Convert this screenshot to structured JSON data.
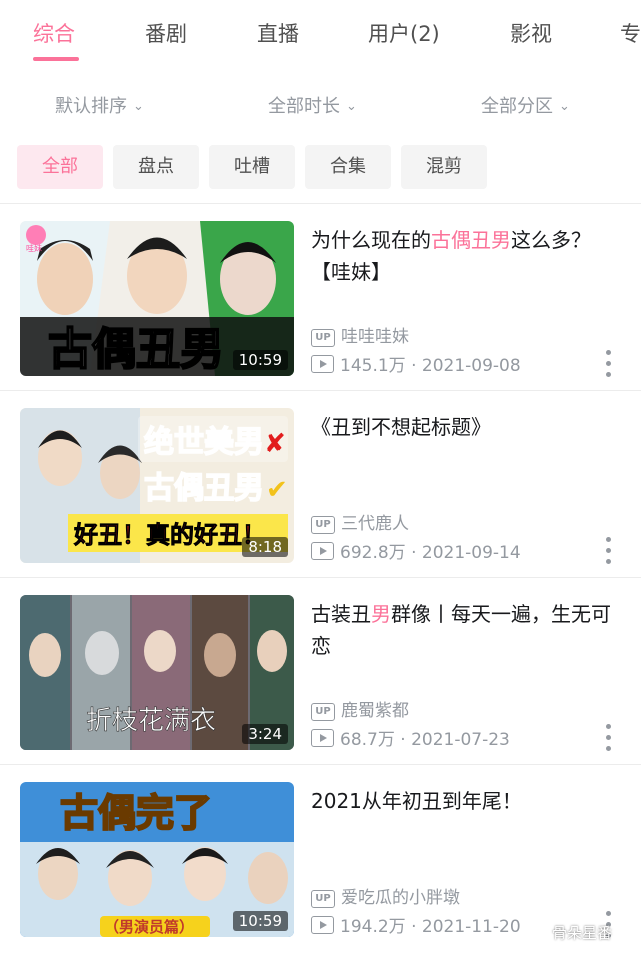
{
  "tabs": [
    {
      "label": "综合",
      "active": true
    },
    {
      "label": "番剧"
    },
    {
      "label": "直播"
    },
    {
      "label": "用户(2)"
    },
    {
      "label": "影视"
    },
    {
      "label": "专"
    }
  ],
  "filters": {
    "sort": "默认排序",
    "duration": "全部时长",
    "zone": "全部分区"
  },
  "chips": [
    "全部",
    "盘点",
    "吐槽",
    "合集",
    "混剪"
  ],
  "videos": [
    {
      "title_pre": "为什么现在的",
      "title_hl": "古偶丑男",
      "title_post": "这么多？【哇妹】",
      "uploader": "哇哇哇妹",
      "views": "145.1万",
      "date": "2021-09-08",
      "duration": "10:59",
      "thumb_text": "古偶丑男",
      "thumb_badge": "哇妹"
    },
    {
      "title_pre": "《丑到不想起标题》",
      "title_hl": "",
      "title_post": "",
      "uploader": "三代鹿人",
      "views": "692.8万",
      "date": "2021-09-14",
      "duration": "8:18",
      "thumb_line1": "绝世美男",
      "thumb_line2": "古偶丑男",
      "thumb_line3": "好丑！真的好丑！"
    },
    {
      "title_pre": "古装丑",
      "title_hl": "男",
      "title_post": "群像丨每天一遍，生无可恋",
      "uploader": "鹿蜀紫都",
      "views": "68.7万",
      "date": "2021-07-23",
      "duration": "3:24",
      "thumb_text": "折枝花满衣"
    },
    {
      "title_pre": "2021从年初丑到年尾！",
      "title_hl": "",
      "title_post": "",
      "uploader": "爱吃瓜的小胖墩",
      "views": "194.2万",
      "date": "2021-11-20",
      "duration": "10:59",
      "thumb_text": "古偶完了",
      "thumb_sub": "（男演员篇）"
    }
  ],
  "icons": {
    "up_badge": "UP",
    "play": "play-count-icon",
    "more": "more-dots-icon"
  },
  "watermark": "骨朵星番",
  "colors": {
    "accent": "#fb7299",
    "meta": "#9499a0",
    "chip_bg": "#f4f4f4"
  }
}
